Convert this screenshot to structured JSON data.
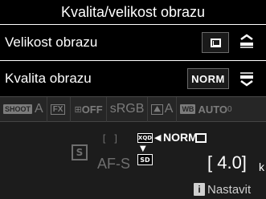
{
  "menu": {
    "title": "Kvalita/velikost obrazu",
    "items": [
      {
        "label": "Velikost obrazu",
        "value_icon": "large-size-icon",
        "dial_icon": "sub-command-dial-icon"
      },
      {
        "label": "Kvalita obrazu",
        "value": "NORM",
        "dial_icon": "main-command-dial-icon"
      }
    ]
  },
  "info": {
    "shoot_badge": "SHOOT",
    "shoot_bank": "A",
    "fx_label": "FX",
    "adl_label": "OFF",
    "color_space": "sRGB",
    "picture_control": "A",
    "wb_badge": "WB",
    "wb_value": "AUTO",
    "wb_sub": "0"
  },
  "status": {
    "mode_icon": "S",
    "af_area_icon": "[ ]",
    "af_mode": "AF-S",
    "primary_card": "XQD",
    "quality": "NORM",
    "secondary_card": "SD",
    "shots_remaining": "[ 4.0]",
    "shots_unit": "k"
  },
  "help": {
    "label": "Nastavit",
    "icon": "i"
  }
}
